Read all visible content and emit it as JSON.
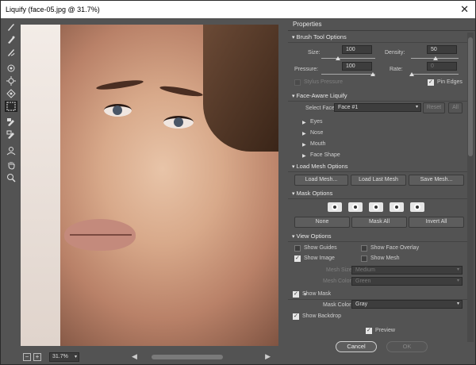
{
  "window": {
    "title": "Liquify (face-05.jpg @ 31.7%)"
  },
  "toolbar": {
    "tools": [
      {
        "name": "forward-warp-tool"
      },
      {
        "name": "reconstruct-tool"
      },
      {
        "name": "smooth-tool"
      },
      {
        "name": "twirl-clockwise-tool"
      },
      {
        "name": "pucker-tool"
      },
      {
        "name": "bloat-tool"
      },
      {
        "name": "face-tool"
      },
      {
        "name": "freeze-mask-tool"
      },
      {
        "name": "thaw-mask-tool"
      },
      {
        "name": "push-left-tool"
      },
      {
        "name": "hand-tool"
      },
      {
        "name": "zoom-tool"
      }
    ]
  },
  "status": {
    "zoom": "31.7%",
    "zoom_out": "−",
    "zoom_in": "+"
  },
  "panel": {
    "title": "Properties",
    "brush": {
      "heading": "Brush Tool Options",
      "size_label": "Size:",
      "size_value": "100",
      "density_label": "Density:",
      "density_value": "50",
      "pressure_label": "Pressure:",
      "pressure_value": "100",
      "rate_label": "Rate:",
      "rate_value": "0",
      "stylus_label": "Stylus Pressure",
      "pin_edges_label": "Pin Edges"
    },
    "face": {
      "heading": "Face-Aware Liquify",
      "select_face_label": "Select Face:",
      "select_face_value": "Face #1",
      "reset_label": "Reset",
      "all_label": "All",
      "groups": [
        "Eyes",
        "Nose",
        "Mouth",
        "Face Shape"
      ]
    },
    "load_mesh": {
      "heading": "Load Mesh Options",
      "load_mesh": "Load Mesh...",
      "load_last": "Load Last Mesh",
      "save_mesh": "Save Mesh..."
    },
    "mask": {
      "heading": "Mask Options",
      "none": "None",
      "mask_all": "Mask All",
      "invert_all": "Invert All"
    },
    "view": {
      "heading": "View Options",
      "show_guides": "Show Guides",
      "show_face_overlay": "Show Face Overlay",
      "show_image": "Show Image",
      "show_mesh": "Show Mesh",
      "mesh_size_label": "Mesh Size:",
      "mesh_size_value": "Medium",
      "mesh_color_label": "Mesh Color:",
      "mesh_color_value": "Green",
      "show_mask": "Show Mask",
      "mask_color_label": "Mask Color:",
      "mask_color_value": "Gray",
      "show_backdrop": "Show Backdrop"
    },
    "preview_label": "Preview",
    "cancel": "Cancel",
    "ok": "OK"
  }
}
